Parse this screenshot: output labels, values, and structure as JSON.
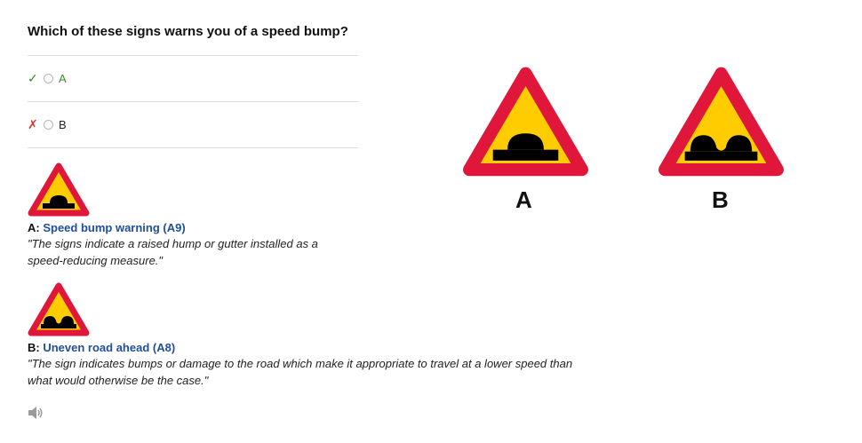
{
  "question": "Which of these signs warns you of a speed bump?",
  "options": [
    {
      "mark": "✓",
      "label": "A",
      "status": "correct"
    },
    {
      "mark": "✗",
      "label": "B",
      "status": "incorrect"
    }
  ],
  "explanations": [
    {
      "key": "A:",
      "name": "Speed bump warning (A9)",
      "quote": "\"The signs indicate a raised hump or gutter installed as a speed-reducing measure.\""
    },
    {
      "key": "B:",
      "name": "Uneven road ahead (A8)",
      "quote": "\"The sign indicates bumps or damage to the road which make it appropriate to travel at a lower speed than what would otherwise be the case.\""
    }
  ],
  "signs": [
    {
      "label": "A",
      "icon": "speed-bump-warning-sign"
    },
    {
      "label": "B",
      "icon": "uneven-road-sign"
    }
  ],
  "audio": {
    "icon": "speaker-icon"
  },
  "colors": {
    "sign_border": "#e0173a",
    "sign_fill": "#ffcc00",
    "correct": "#3a8a2a",
    "incorrect": "#d9352f",
    "link": "#1f4e9a"
  }
}
